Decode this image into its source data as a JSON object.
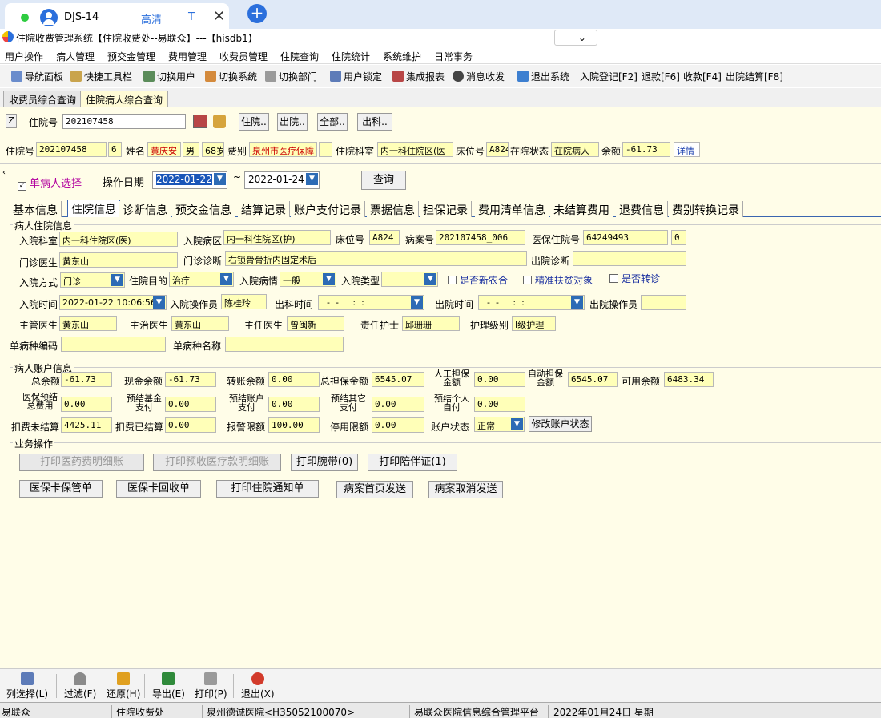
{
  "browser": {
    "tab_title": "DJS-14",
    "quality": "高清",
    "t_label": "T",
    "close": "✕",
    "new_tab": "+"
  },
  "window": {
    "title": "住院收费管理系统【住院收费处--易联众】---【hisdb1】",
    "min_label": "—  ⌄"
  },
  "menu": [
    "用户操作",
    "病人管理",
    "预交金管理",
    "费用管理",
    "收费员管理",
    "住院查询",
    "住院统计",
    "系统维护",
    "日常事务"
  ],
  "toolbar": [
    "导航面板",
    "快捷工具栏",
    "切换用户",
    "切换系统",
    "切换部门",
    "用户锁定",
    "集成报表",
    "消息收发",
    "退出系统",
    "入院登记[F2]",
    "退款[F6]",
    "收款[F4]",
    "出院结算[F8]"
  ],
  "page_tabs": [
    "收费员综合查询",
    "住院病人综合查询"
  ],
  "search": {
    "z": "Z",
    "label": "住院号",
    "value": "202107458",
    "btn_in": "住院..",
    "btn_out": "出院..",
    "btn_all": "全部..",
    "btn_dept": "出科.."
  },
  "summary": {
    "hosp_no_label": "住院号",
    "hosp_no": "202107458",
    "times": "6",
    "name_label": "姓名",
    "name": "黄庆安",
    "sex": "男",
    "age": "68岁",
    "fee_label": "费别",
    "fee": "泉州市医疗保障",
    "blank": "",
    "dept_label": "住院科室",
    "dept": "内一科住院区(医",
    "bed_label": "床位号",
    "bed": "A824",
    "status_label": "在院状态",
    "status": "在院病人",
    "balance_label": "余额",
    "balance": "-61.73",
    "detail": "详情"
  },
  "filter": {
    "single": "单病人选择",
    "date_label": "操作日期",
    "date_from": "2022-01-22",
    "tilde": "~",
    "date_to": "2022-01-24",
    "query": "查询"
  },
  "detail_tabs": [
    "基本信息",
    "住院信息",
    "诊断信息",
    "预交金信息",
    "结算记录",
    "账户支付记录",
    "票据信息",
    "担保记录",
    "费用清单信息",
    "未结算费用",
    "退费信息",
    "费别转换记录"
  ],
  "inpatient": {
    "group": "病人住院信息",
    "adm_dept_label": "入院科室",
    "adm_dept": "内一科住院区(医)",
    "adm_ward_label": "入院病区",
    "adm_ward": "内一科住院区(护)",
    "bed_label": "床位号",
    "bed": "A824",
    "case_label": "病案号",
    "case_no": "202107458_006",
    "ins_label": "医保住院号",
    "ins_no": "64249493",
    "ins_extra": "0",
    "op_doc_label": "门诊医生",
    "op_doc": "黄东山",
    "op_diag_label": "门诊诊断",
    "op_diag": "右锁骨骨折内固定术后",
    "dis_diag_label": "出院诊断",
    "dis_diag": "",
    "adm_way_label": "入院方式",
    "adm_way": "门诊",
    "purpose_label": "住院目的",
    "purpose": "治疗",
    "cond_label": "入院病情",
    "cond": "一般",
    "type_label": "入院类型",
    "type": "",
    "chk1": "是否新农合",
    "chk2": "精准扶贫对象",
    "chk3": "是否转诊",
    "adm_time_label": "入院时间",
    "adm_time": "2022-01-22 10:06:56",
    "adm_op_label": "入院操作员",
    "adm_op": "陈桂玲",
    "out_dept_label": "出科时间",
    "out_dept": "  -  -     :  :",
    "out_time_label": "出院时间",
    "out_time": "  -  -     :  :",
    "out_op_label": "出院操作员",
    "out_op": "",
    "chief_label": "主管医生",
    "chief": "黄东山",
    "attend_label": "主治医生",
    "attend": "黄东山",
    "director_label": "主任医生",
    "director": "曾闽新",
    "nurse_label": "责任护士",
    "nurse": "邱珊珊",
    "care_label": "护理级别",
    "care": "Ⅰ级护理",
    "sd_code_label": "单病种编码",
    "sd_code": "",
    "sd_name_label": "单病种名称",
    "sd_name": ""
  },
  "account": {
    "group": "病人账户信息",
    "total_label": "总余额",
    "total": "-61.73",
    "cash_label": "现金余额",
    "cash": "-61.73",
    "transfer_label": "转账余额",
    "transfer": "0.00",
    "guar_label": "总担保金额",
    "guar": "6545.07",
    "manual_label": "人工担保金额",
    "manual": "0.00",
    "auto_label": "自动担保金额",
    "auto": "6545.07",
    "avail_label": "可用余额",
    "avail": "6483.34",
    "pre_total_label": "医保预结总费用",
    "pre_total": "0.00",
    "pre_fund_label": "预结基金支付",
    "pre_fund": "0.00",
    "pre_acct_label": "预结账户支付",
    "pre_acct": "0.00",
    "pre_other_label": "预结其它支付",
    "pre_other": "0.00",
    "pre_self_label": "预结个人自付",
    "pre_self": "0.00",
    "unsettled_label": "扣费未结算",
    "unsettled": "4425.11",
    "settled_label": "扣费已结算",
    "settled": "0.00",
    "alarm_label": "报警限额",
    "alarm": "100.00",
    "stop_label": "停用限额",
    "stop": "0.00",
    "acct_status_label": "账户状态",
    "acct_status": "正常",
    "modify": "修改账户状态"
  },
  "business": {
    "group": "业务操作",
    "b1": "打印医药费明细账",
    "b2": "打印预收医疗款明细账",
    "b3": "打印腕带(0)",
    "b4": "打印陪伴证(1)",
    "b5": "医保卡保管单",
    "b6": "医保卡回收单",
    "b7": "打印住院通知单",
    "b8": "病案首页发送",
    "b9": "病案取消发送"
  },
  "bottom": [
    "列选择(L)",
    "过滤(F)",
    "还原(H)",
    "导出(E)",
    "打印(P)",
    "退出(X)"
  ],
  "status": [
    "易联众",
    "住院收费处",
    "泉州德诚医院<H35052100070>",
    "易联众医院信息综合管理平台",
    "2022年01月24日 星期一"
  ]
}
